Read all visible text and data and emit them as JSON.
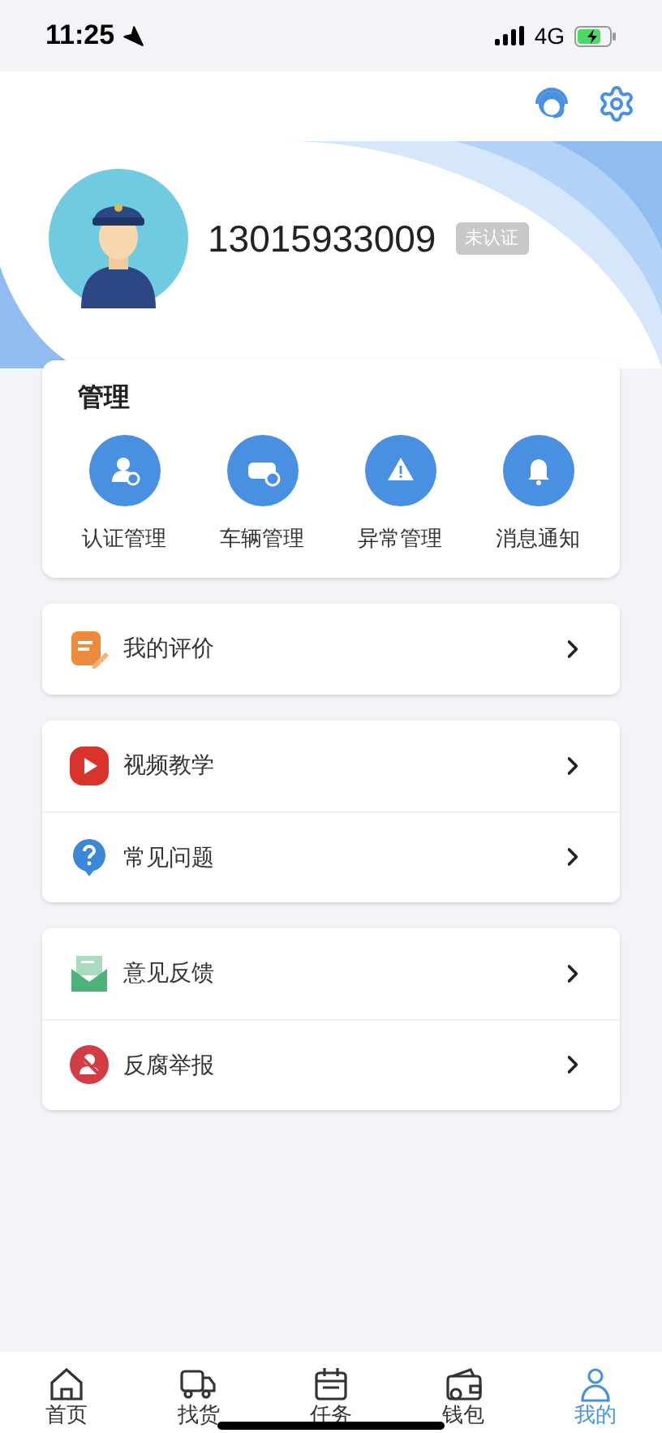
{
  "status_bar": {
    "time": "11:25",
    "network": "4G"
  },
  "profile": {
    "phone": "13015933009",
    "badge": "未认证"
  },
  "management": {
    "title": "管理",
    "items": [
      {
        "kind": "cert",
        "label": "认证管理"
      },
      {
        "kind": "vehicle",
        "label": "车辆管理"
      },
      {
        "kind": "warning",
        "label": "异常管理"
      },
      {
        "kind": "bell",
        "label": "消息通知"
      }
    ]
  },
  "menu_groups": [
    [
      {
        "kind": "review",
        "label": "我的评价"
      }
    ],
    [
      {
        "kind": "video",
        "label": "视频教学"
      },
      {
        "kind": "faq",
        "label": "常见问题"
      }
    ],
    [
      {
        "kind": "feedback",
        "label": "意见反馈"
      },
      {
        "kind": "report",
        "label": "反腐举报"
      }
    ]
  ],
  "tab_bar": [
    {
      "kind": "home",
      "label": "首页",
      "selected": false
    },
    {
      "kind": "truck",
      "label": "找货",
      "selected": false
    },
    {
      "kind": "calendar",
      "label": "任务",
      "selected": false
    },
    {
      "kind": "wallet",
      "label": "钱包",
      "selected": false
    },
    {
      "kind": "user",
      "label": "我的",
      "selected": true
    }
  ]
}
